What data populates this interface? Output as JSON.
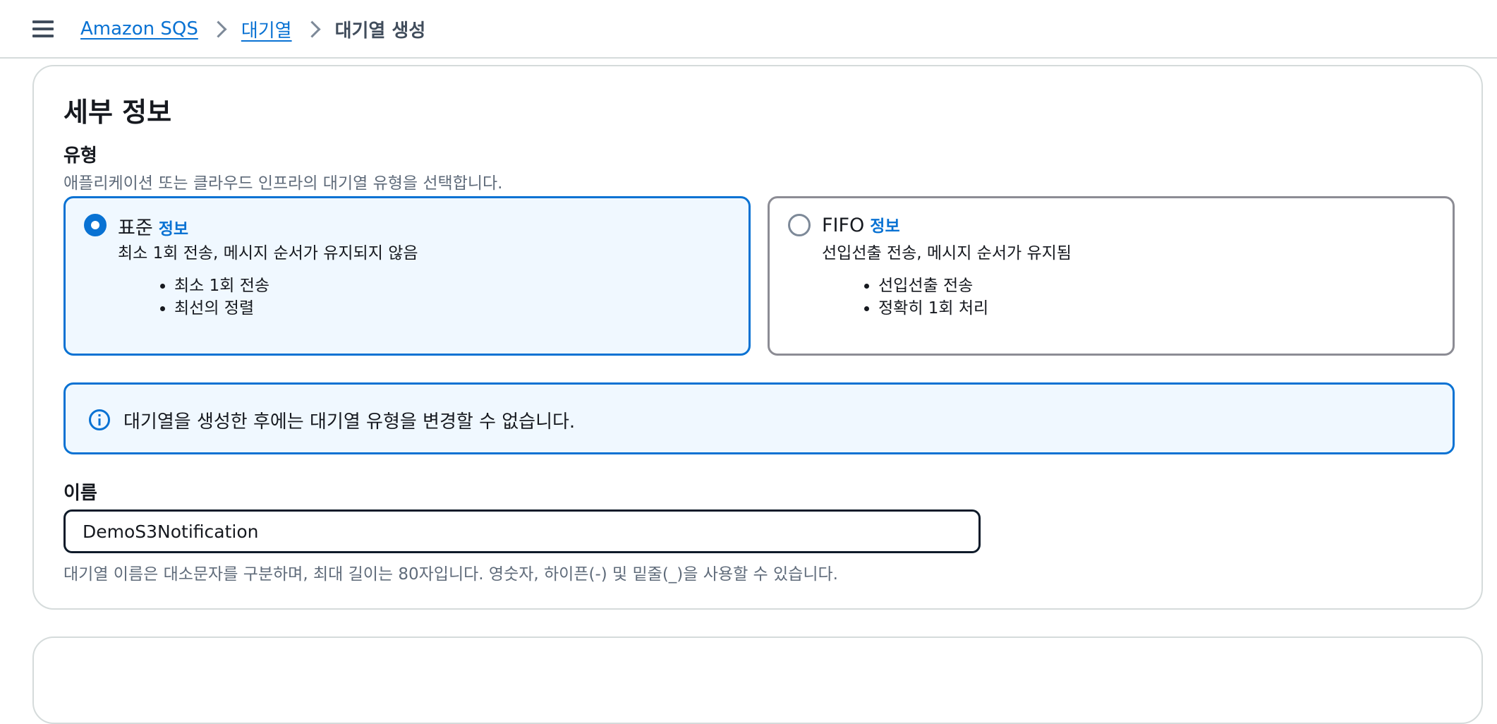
{
  "breadcrumb": {
    "items": [
      "Amazon SQS",
      "대기열"
    ],
    "current": "대기열 생성"
  },
  "details": {
    "title": "세부 정보",
    "type_field": {
      "label": "유형",
      "description": "애플리케이션 또는 클라우드 인프라의 대기열 유형을 선택합니다.",
      "options": [
        {
          "title": "표준",
          "info": "정보",
          "selected": true,
          "description": "최소 1회 전송, 메시지 순서가 유지되지 않음",
          "bullets": [
            "최소 1회 전송",
            "최선의 정렬"
          ]
        },
        {
          "title": "FIFO",
          "info": "정보",
          "selected": false,
          "description": "선입선출 전송, 메시지 순서가 유지됨",
          "bullets": [
            "선입선출 전송",
            "정확히 1회 처리"
          ]
        }
      ]
    },
    "alert": {
      "icon": "info-icon",
      "text": "대기열을 생성한 후에는 대기열 유형을 변경할 수 없습니다."
    },
    "name_field": {
      "label": "이름",
      "value": "DemoS3Notification",
      "constraint": "대기열 이름은 대소문자를 구분하며, 최대 길이는 80자입니다. 영숫자, 하이픈(-) 및 밑줄(_)을 사용할 수 있습니다."
    }
  },
  "colors": {
    "accent": "#0972d3",
    "selected_tile_bg": "#f0f8ff",
    "text": "#16191f",
    "muted_text": "#5f6b7a"
  }
}
